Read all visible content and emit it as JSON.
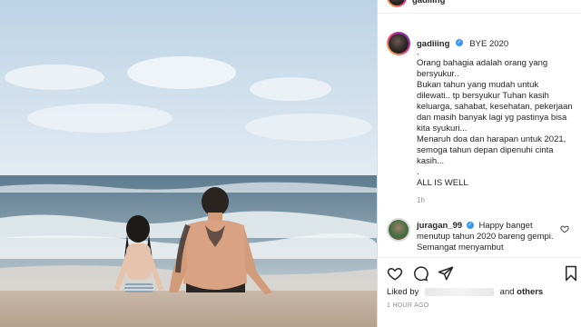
{
  "post": {
    "username": "gadiiing",
    "title": "BYE 2020",
    "caption": ".\nOrang bahagia adalah orang yang bersyukur..\nBukan tahun yang mudah untuk dilewati.. tp bersyukur Tuhan kasih keluarga, sahabat, kesehatan, pekerjaan dan masih banyak lagi yg pastinya bisa kita syukuri...\nMenaruh doa dan harapan untuk 2021, semoga tahun depan dipenuhi cinta kasih...\n.\nALL IS WELL",
    "caption_time": "1h"
  },
  "comment": {
    "username": "juragan_99",
    "text": "Happy banget menutup tahun 2020 bareng gempi. Semangat menyambut"
  },
  "likes": {
    "prefix": "Liked by",
    "joiner": "and",
    "others": "others"
  },
  "posted_ago": "1 HOUR AGO",
  "icons": {
    "verified": "verified-badge-icon",
    "like": "heart-icon",
    "comment": "comment-bubble-icon",
    "share": "paper-plane-icon",
    "save": "bookmark-icon"
  },
  "colors": {
    "verified_blue": "#3897f0",
    "text": "#262626",
    "muted": "#8e8e8e",
    "sky": "#c9dced",
    "sea": "#5f7f93"
  }
}
